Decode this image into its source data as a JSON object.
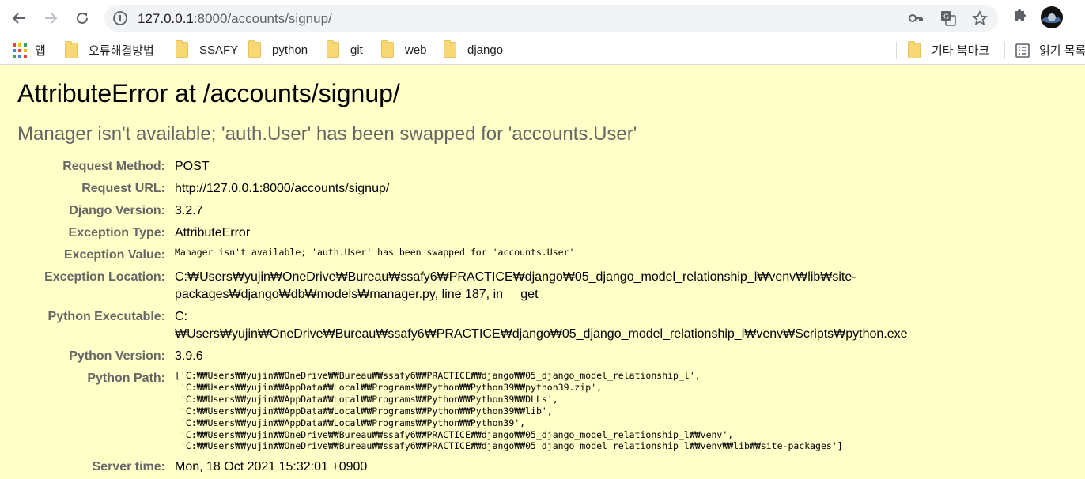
{
  "browser": {
    "url_host": "127.0.0.1",
    "url_rest": ":8000/accounts/signup/",
    "bookmarks": [
      {
        "label": "앱"
      },
      {
        "label": "오류해결방법"
      },
      {
        "label": "SSAFY"
      },
      {
        "label": "python"
      },
      {
        "label": "git"
      },
      {
        "label": "web"
      },
      {
        "label": "django"
      }
    ],
    "other_bookmarks": "기타 북마크",
    "reading_list": "읽기 목록"
  },
  "error": {
    "title": "AttributeError at /accounts/signup/",
    "summary": "Manager isn't available; 'auth.User' has been swapped for 'accounts.User'"
  },
  "meta": {
    "request_method_label": "Request Method:",
    "request_method": "POST",
    "request_url_label": "Request URL:",
    "request_url": "http://127.0.0.1:8000/accounts/signup/",
    "django_version_label": "Django Version:",
    "django_version": "3.2.7",
    "exception_type_label": "Exception Type:",
    "exception_type": "AttributeError",
    "exception_value_label": "Exception Value:",
    "exception_value": "Manager isn't available; 'auth.User' has been swapped for 'accounts.User'",
    "exception_location_label": "Exception Location:",
    "exception_location": "C:₩Users₩yujin₩OneDrive₩Bureau₩ssafy6₩PRACTICE₩django₩05_django_model_relationship_l₩venv₩lib₩site-packages₩django₩db₩models₩manager.py, line 187, in __get__",
    "python_executable_label": "Python Executable:",
    "python_executable": "C:₩Users₩yujin₩OneDrive₩Bureau₩ssafy6₩PRACTICE₩django₩05_django_model_relationship_l₩venv₩Scripts₩python.exe",
    "python_version_label": "Python Version:",
    "python_version": "3.9.6",
    "python_path_label": "Python Path:",
    "python_path": "['C:₩₩Users₩₩yujin₩₩OneDrive₩₩Bureau₩₩ssafy6₩₩PRACTICE₩₩django₩₩05_django_model_relationship_l',\n 'C:₩₩Users₩₩yujin₩₩AppData₩₩Local₩₩Programs₩₩Python₩₩Python39₩₩python39.zip',\n 'C:₩₩Users₩₩yujin₩₩AppData₩₩Local₩₩Programs₩₩Python₩₩Python39₩₩DLLs',\n 'C:₩₩Users₩₩yujin₩₩AppData₩₩Local₩₩Programs₩₩Python₩₩Python39₩₩lib',\n 'C:₩₩Users₩₩yujin₩₩AppData₩₩Local₩₩Programs₩₩Python₩₩Python39',\n 'C:₩₩Users₩₩yujin₩₩OneDrive₩₩Bureau₩₩ssafy6₩₩PRACTICE₩₩django₩₩05_django_model_relationship_l₩₩venv',\n 'C:₩₩Users₩₩yujin₩₩OneDrive₩₩Bureau₩₩ssafy6₩₩PRACTICE₩₩django₩₩05_django_model_relationship_l₩₩venv₩₩lib₩₩site-packages']",
    "server_time_label": "Server time:",
    "server_time": "Mon, 18 Oct 2021 15:32:01 +0900"
  }
}
